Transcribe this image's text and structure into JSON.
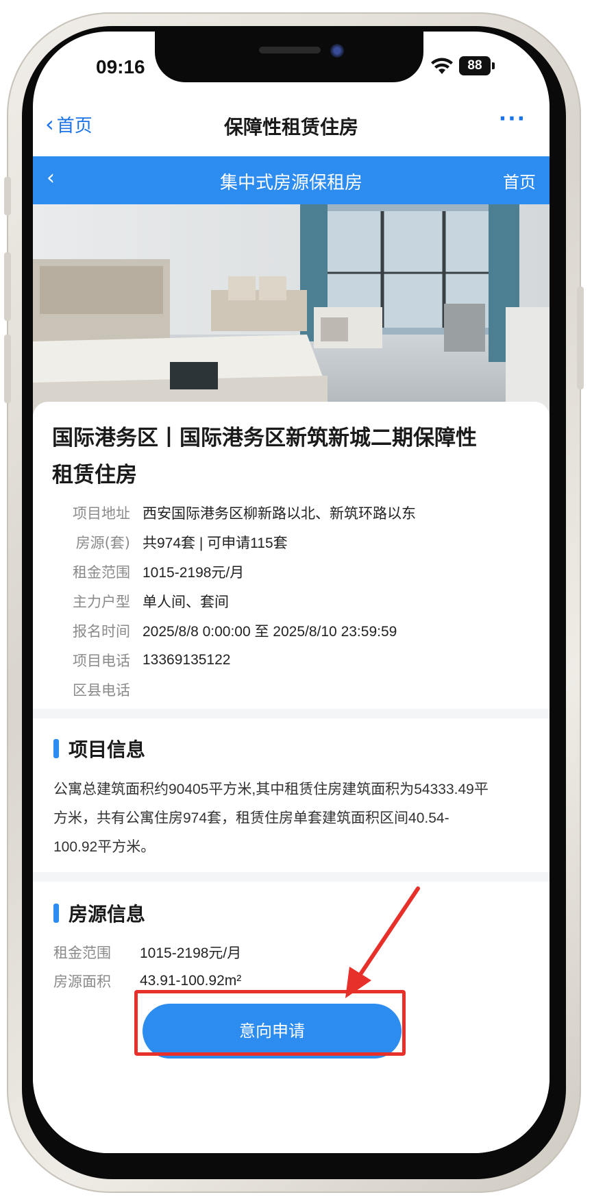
{
  "status_bar": {
    "time": "09:16",
    "battery": "88"
  },
  "top_nav": {
    "back_label": "首页",
    "title": "保障性租赁住房",
    "more": "···"
  },
  "sub_nav": {
    "back": "‹",
    "title": "集中式房源保租房",
    "home": "首页"
  },
  "project": {
    "title": "国际港务区丨国际港务区新筑新城二期保障性租赁住房",
    "rows": [
      {
        "label": "项目地址",
        "value": "西安国际港务区柳新路以北、新筑环路以东"
      },
      {
        "label": "房源(套)",
        "value": "共974套 | 可申请115套"
      },
      {
        "label": "租金范围",
        "value": "1015-2198元/月"
      },
      {
        "label": "主力户型",
        "value": "单人间、套间"
      },
      {
        "label": "报名时间",
        "value": "2025/8/8 0:00:00 至 2025/8/10 23:59:59"
      },
      {
        "label": "项目电话",
        "value": "13369135122"
      },
      {
        "label": "区县电话",
        "value": ""
      }
    ]
  },
  "project_info": {
    "heading": "项目信息",
    "description": "公寓总建筑面积约90405平方米,其中租赁住房建筑面积为54333.49平方米，共有公寓住房974套，租赁住房单套建筑面积区间40.54-100.92平方米。"
  },
  "house_info": {
    "heading": "房源信息",
    "rows": [
      {
        "label": "租金范围",
        "value": "1015-2198元/月"
      },
      {
        "label": "房源面积",
        "value": "43.91-100.92m²"
      }
    ]
  },
  "apply_button": "意向申请",
  "colors": {
    "accent": "#2d8cf0",
    "link": "#1a73e8",
    "annotation": "#e8302a"
  }
}
